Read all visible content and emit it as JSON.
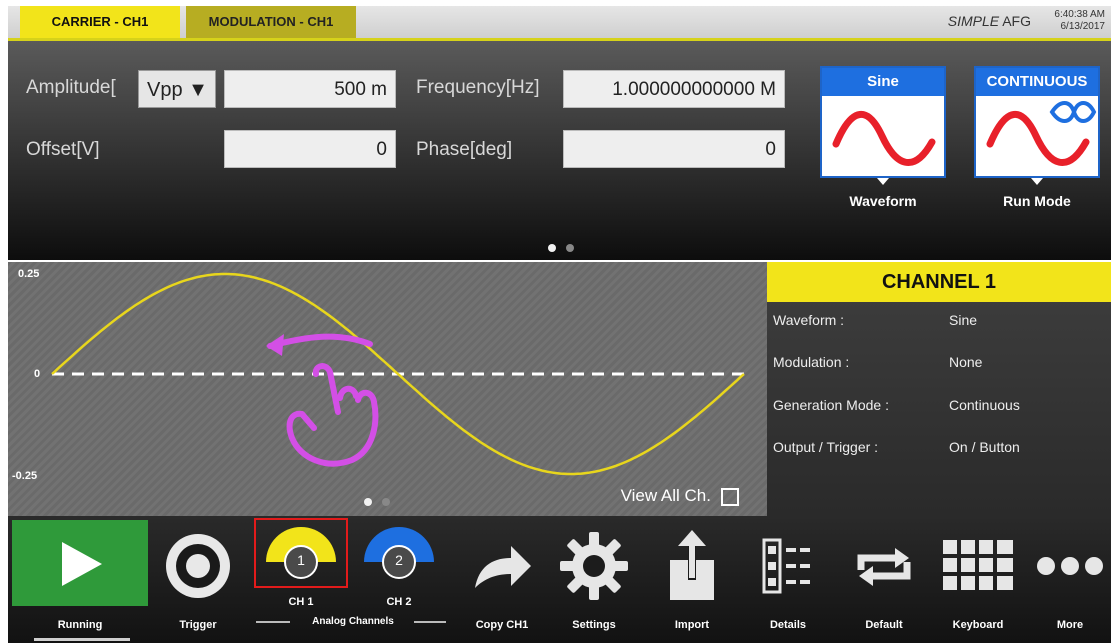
{
  "tabs": {
    "carrier": "CARRIER - CH1",
    "modulation": "MODULATION - CH1"
  },
  "brand": {
    "italic": "SIMPLE",
    "name": "AFG"
  },
  "clock": {
    "time": "6:40:38 AM",
    "date": "6/13/2017"
  },
  "carrier": {
    "amplitude_label": "Amplitude[",
    "amplitude_unit": "Vpp ▼",
    "amplitude_value": "500 m",
    "frequency_label": "Frequency[Hz]",
    "frequency_value": "1.000000000000 M",
    "offset_label": "Offset[V]",
    "offset_value": "0",
    "phase_label": "Phase[deg]",
    "phase_value": "0",
    "waveform_card": {
      "title": "Sine",
      "caption": "Waveform"
    },
    "runmode_card": {
      "title": "CONTINUOUS",
      "caption": "Run Mode"
    }
  },
  "plot": {
    "y_max_label": "0.25",
    "y_zero_label": "0",
    "y_min_label": "-0.25",
    "view_all_label": "View All Ch."
  },
  "channel": {
    "title": "CHANNEL 1",
    "rows": [
      {
        "key": "Waveform :",
        "value": "Sine"
      },
      {
        "key": "Modulation :",
        "value": "None"
      },
      {
        "key": "Generation Mode :",
        "value": "Continuous"
      },
      {
        "key": "Output / Trigger :",
        "value": "On / Button"
      }
    ]
  },
  "toolbar": {
    "running": "Running",
    "trigger": "Trigger",
    "ch1_number": "1",
    "ch1_label": "CH 1",
    "ch2_number": "2",
    "ch2_label": "CH 2",
    "analog_channels": "Analog Channels",
    "copy": "Copy CH1",
    "settings": "Settings",
    "import": "Import",
    "details": "Details",
    "default": "Default",
    "keyboard": "Keyboard",
    "more": "More"
  },
  "colors": {
    "accent_yellow": "#f2e41a",
    "blue": "#1e6fe0",
    "wave_red": "#e8202a",
    "run_green": "#2f9a3a",
    "gesture_magenta": "#d34fe6"
  }
}
